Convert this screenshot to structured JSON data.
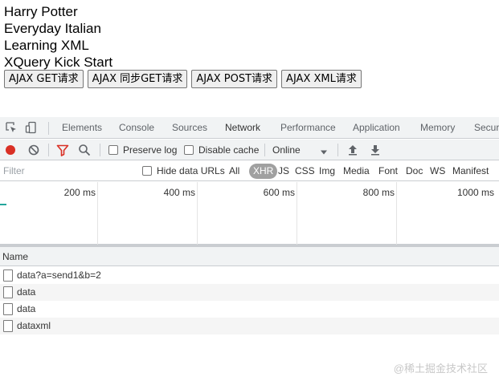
{
  "books": [
    "Harry Potter",
    "Everyday Italian",
    "Learning XML",
    "XQuery Kick Start"
  ],
  "buttons": {
    "ajax_get": "AJAX GET请求",
    "ajax_sync_get": "AJAX 同步GET请求",
    "ajax_post": "AJAX POST请求",
    "ajax_xml": "AJAX XML请求"
  },
  "devtools": {
    "tabs": [
      "Elements",
      "Console",
      "Sources",
      "Network",
      "Performance",
      "Application",
      "Memory",
      "Secur"
    ],
    "active_tab": "Network",
    "toolbar": {
      "preserve_log": "Preserve log",
      "disable_cache": "Disable cache",
      "throttling": "Online"
    },
    "filter": {
      "placeholder": "Filter",
      "hide_data_urls": "Hide data URLs",
      "types": [
        "All",
        "XHR",
        "JS",
        "CSS",
        "Img",
        "Media",
        "Font",
        "Doc",
        "WS",
        "Manifest"
      ],
      "active_type": "XHR"
    },
    "timeline_ticks": [
      "200 ms",
      "400 ms",
      "600 ms",
      "800 ms",
      "1000 ms"
    ],
    "table": {
      "name_header": "Name",
      "rows": [
        "data?a=send1&b=2",
        "data",
        "data",
        "dataxml"
      ]
    },
    "colors": {
      "record": "#d93025",
      "accent": "#1a73e8",
      "filter_icon": "#d93025"
    }
  },
  "watermark": "@稀土掘金技术社区"
}
